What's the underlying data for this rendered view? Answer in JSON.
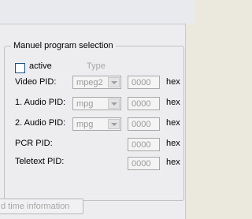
{
  "group": {
    "title": "Manuel program selection"
  },
  "active": {
    "label": "active",
    "checked": false
  },
  "type_label": "Type",
  "rows": [
    {
      "label": "Video PID:",
      "combo": "mpeg2",
      "pid": "0000",
      "unit": "hex"
    },
    {
      "label": "1. Audio PID:",
      "combo": "mpg",
      "pid": "0000",
      "unit": "hex"
    },
    {
      "label": "2. Audio PID:",
      "combo": "mpg",
      "pid": "0000",
      "unit": "hex"
    },
    {
      "label": "PCR PID:",
      "pid": "0000",
      "unit": "hex"
    },
    {
      "label": "Teletext PID:",
      "pid": "0000",
      "unit": "hex"
    }
  ],
  "realtime_button": {
    "label": "d time information"
  }
}
